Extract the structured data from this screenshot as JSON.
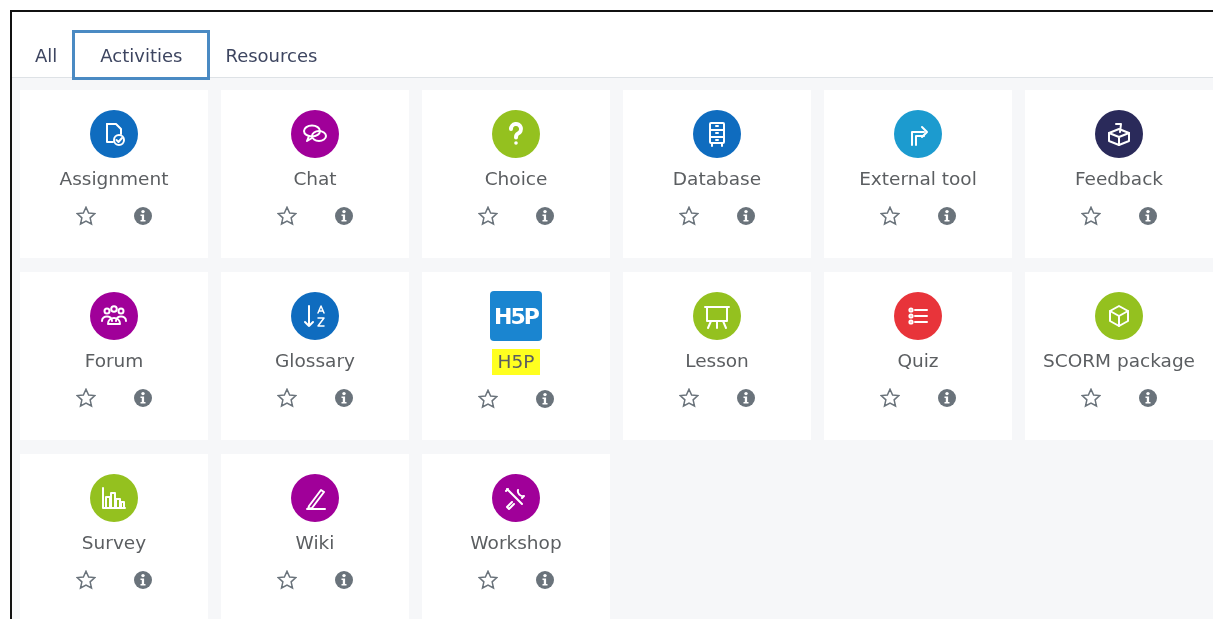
{
  "tabs": [
    {
      "label": "All",
      "selected": false
    },
    {
      "label": "Activities",
      "selected": true
    },
    {
      "label": "Resources",
      "selected": false
    }
  ],
  "activities": [
    {
      "name": "Assignment",
      "color": "#0f6cbf",
      "kind": "circle",
      "starred": false,
      "highlighted": false
    },
    {
      "name": "Chat",
      "color": "#a00099",
      "kind": "circle",
      "starred": false,
      "highlighted": false
    },
    {
      "name": "Choice",
      "color": "#94c11f",
      "kind": "circle",
      "starred": false,
      "highlighted": false
    },
    {
      "name": "Database",
      "color": "#0f6cbf",
      "kind": "circle",
      "starred": false,
      "highlighted": false
    },
    {
      "name": "External tool",
      "color": "#1c9bcf",
      "kind": "circle",
      "starred": false,
      "highlighted": false
    },
    {
      "name": "Feedback",
      "color": "#2a2a5a",
      "kind": "circle",
      "starred": false,
      "highlighted": false
    },
    {
      "name": "Forum",
      "color": "#a00099",
      "kind": "circle",
      "starred": false,
      "highlighted": false
    },
    {
      "name": "Glossary",
      "color": "#0f6cbf",
      "kind": "circle",
      "starred": false,
      "highlighted": false
    },
    {
      "name": "H5P",
      "color": "#1a85d0",
      "kind": "logo",
      "logo_text": "H5P",
      "starred": false,
      "highlighted": true
    },
    {
      "name": "Lesson",
      "color": "#94c11f",
      "kind": "circle",
      "starred": false,
      "highlighted": false
    },
    {
      "name": "Quiz",
      "color": "#e8343a",
      "kind": "circle",
      "starred": false,
      "highlighted": false
    },
    {
      "name": "SCORM package",
      "color": "#94c11f",
      "kind": "circle",
      "starred": false,
      "highlighted": false
    },
    {
      "name": "Survey",
      "color": "#94c11f",
      "kind": "circle",
      "starred": false,
      "highlighted": false
    },
    {
      "name": "Wiki",
      "color": "#a00099",
      "kind": "circle",
      "starred": false,
      "highlighted": false
    },
    {
      "name": "Workshop",
      "color": "#a00099",
      "kind": "circle",
      "starred": false,
      "highlighted": false
    }
  ]
}
